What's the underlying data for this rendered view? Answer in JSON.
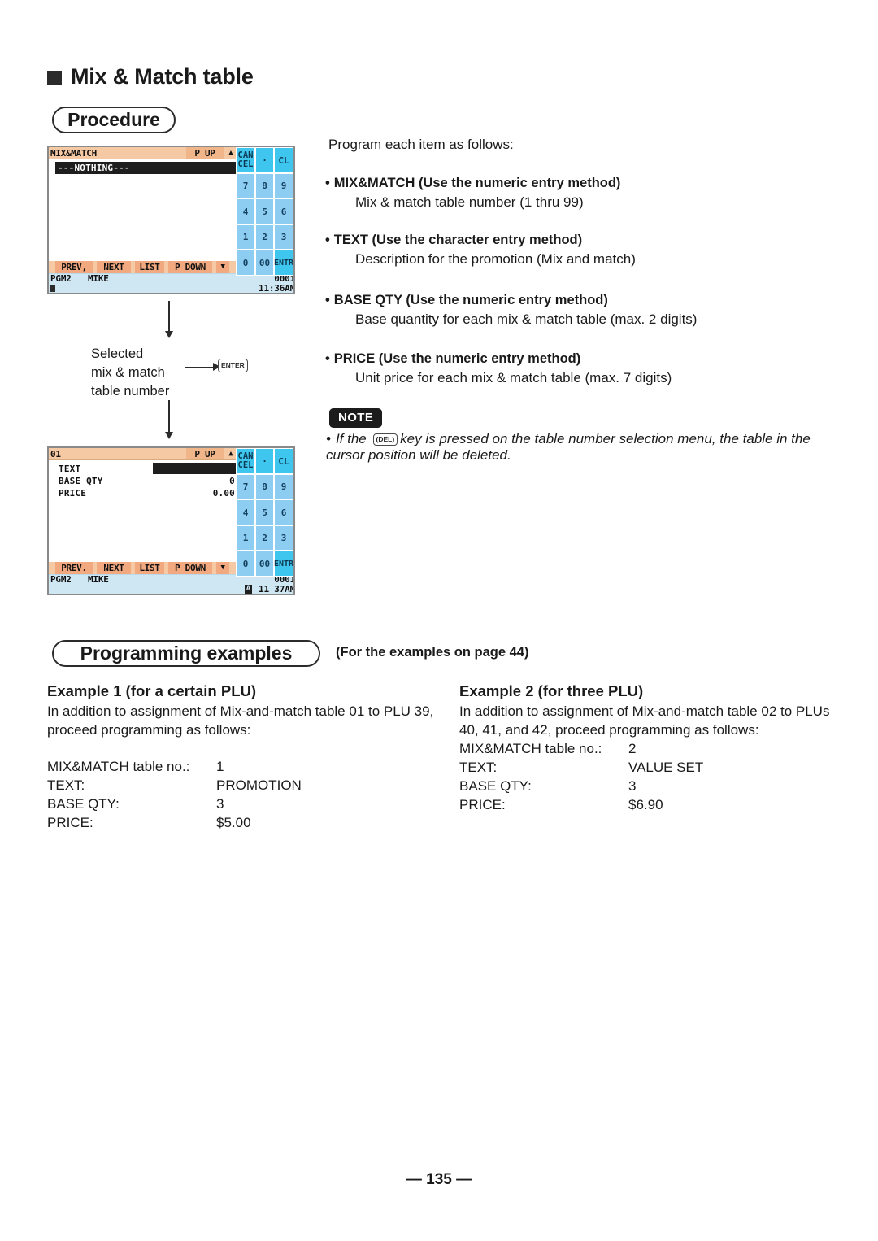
{
  "heading": {
    "title": "Mix & Match table",
    "procedure_label": "Procedure",
    "examples_label": "Programming examples",
    "examples_note": "(For the examples on page 44)"
  },
  "intro": "Program each item as follows:",
  "items": [
    {
      "bullet": "•",
      "head": "MIX&MATCH (Use the numeric entry method)",
      "body": "Mix & match table number (1 thru 99)"
    },
    {
      "bullet": "•",
      "head": "TEXT (Use the character entry method)",
      "body": "Description for the promotion (Mix and match)"
    },
    {
      "bullet": "•",
      "head": "BASE QTY (Use the numeric entry method)",
      "body": "Base quantity for each mix & match table (max. 2 digits)"
    },
    {
      "bullet": "•",
      "head": "PRICE (Use the numeric entry method)",
      "body": "Unit price for each mix & match table (max. 7 digits)"
    }
  ],
  "note": {
    "badge": "NOTE",
    "bullet": "•",
    "text_before": "If the",
    "keycap": "(DEL)",
    "text_after": "key is pressed on the table number selection menu, the table in the cursor position will be deleted."
  },
  "flow": {
    "label_line1": "Selected",
    "label_line2": "mix & match",
    "label_line3": "table number",
    "enter_key": "ENTER"
  },
  "screen1": {
    "title": "MIX&MATCH",
    "page_up": "P UP",
    "up_arrow": "▲",
    "selected_row": "---NOTHING---",
    "fn": [
      {
        "label": "PREV,",
        "w": "w1"
      },
      {
        "label": "NEXT",
        "w": "w2"
      },
      {
        "label": "LIST",
        "w": "w3"
      },
      {
        "label": "P DOWN",
        "w": "w4"
      },
      {
        "label": "▼",
        "w": "wa"
      }
    ],
    "status": {
      "mode": "PGM2",
      "clerk": "MIKE",
      "number": "0001",
      "time": "11:36AM",
      "amode": ""
    },
    "keys": [
      {
        "label": "CAN\nCEL",
        "bright": true,
        "name": "cancel"
      },
      {
        "label": "·",
        "bright": true,
        "name": "decimal-point"
      },
      {
        "label": "CL",
        "bright": true,
        "name": "clear"
      },
      {
        "label": "7",
        "bright": false,
        "name": "7"
      },
      {
        "label": "8",
        "bright": false,
        "name": "8"
      },
      {
        "label": "9",
        "bright": false,
        "name": "9"
      },
      {
        "label": "4",
        "bright": false,
        "name": "4"
      },
      {
        "label": "5",
        "bright": false,
        "name": "5"
      },
      {
        "label": "6",
        "bright": false,
        "name": "6"
      },
      {
        "label": "1",
        "bright": false,
        "name": "1"
      },
      {
        "label": "2",
        "bright": false,
        "name": "2"
      },
      {
        "label": "3",
        "bright": false,
        "name": "3"
      },
      {
        "label": "0",
        "bright": false,
        "name": "0"
      },
      {
        "label": "00",
        "bright": false,
        "name": "00"
      },
      {
        "label": "ENTR",
        "bright": true,
        "name": "enter"
      }
    ]
  },
  "screen2": {
    "title": "01",
    "page_up": "P UP",
    "up_arrow": "▲",
    "fields": [
      {
        "label": "TEXT",
        "value": "",
        "highlight": true
      },
      {
        "label": "BASE QTY",
        "value": "0",
        "highlight": false
      },
      {
        "label": "PRICE",
        "value": "0.00",
        "highlight": false
      }
    ],
    "fn": [
      {
        "label": "PREV.",
        "w": "w1"
      },
      {
        "label": "NEXT",
        "w": "w2"
      },
      {
        "label": "LIST",
        "w": "w3"
      },
      {
        "label": "P DOWN",
        "w": "w4"
      },
      {
        "label": "▼",
        "w": "wa"
      }
    ],
    "status": {
      "mode": "PGM2",
      "clerk": "MIKE",
      "number": "0001",
      "time": "11 37AM",
      "amode": "A"
    },
    "keys": [
      {
        "label": "CAN\nCEL",
        "bright": true,
        "name": "cancel"
      },
      {
        "label": "·",
        "bright": true,
        "name": "decimal-point"
      },
      {
        "label": "CL",
        "bright": true,
        "name": "clear"
      },
      {
        "label": "7",
        "bright": false,
        "name": "7"
      },
      {
        "label": "8",
        "bright": false,
        "name": "8"
      },
      {
        "label": "9",
        "bright": false,
        "name": "9"
      },
      {
        "label": "4",
        "bright": false,
        "name": "4"
      },
      {
        "label": "5",
        "bright": false,
        "name": "5"
      },
      {
        "label": "6",
        "bright": false,
        "name": "6"
      },
      {
        "label": "1",
        "bright": false,
        "name": "1"
      },
      {
        "label": "2",
        "bright": false,
        "name": "2"
      },
      {
        "label": "3",
        "bright": false,
        "name": "3"
      },
      {
        "label": "0",
        "bright": false,
        "name": "0"
      },
      {
        "label": "00",
        "bright": false,
        "name": "00"
      },
      {
        "label": "ENTR",
        "bright": true,
        "name": "enter"
      }
    ]
  },
  "example1": {
    "title": "Example 1 (for a certain PLU)",
    "para": "In addition to assignment of Mix-and-match table 01 to PLU 39, proceed programming as follows:",
    "rows": [
      {
        "key": "MIX&MATCH table no.:",
        "value": "1"
      },
      {
        "key": "TEXT:",
        "value": "PROMOTION"
      },
      {
        "key": "BASE QTY:",
        "value": "3"
      },
      {
        "key": "PRICE:",
        "value": "$5.00"
      }
    ]
  },
  "example2": {
    "title": "Example 2 (for three PLU)",
    "para": "In addition to assignment of Mix-and-match table 02 to PLUs 40, 41, and 42, proceed programming as follows:",
    "rows": [
      {
        "key": "MIX&MATCH table no.:",
        "value": "2"
      },
      {
        "key": "TEXT:",
        "value": "VALUE SET"
      },
      {
        "key": "BASE QTY:",
        "value": "3"
      },
      {
        "key": "PRICE:",
        "value": "$6.90"
      }
    ]
  },
  "footer": "— 135 —",
  "colors": {
    "lcd_titlebar": "#f5c9a4",
    "lcd_fn_button": "#f3a97f",
    "lcd_status": "#cfe6f3",
    "key_normal": "#8ecdf2",
    "key_bright": "#3fc6ef",
    "ink": "#1a1a1a"
  }
}
